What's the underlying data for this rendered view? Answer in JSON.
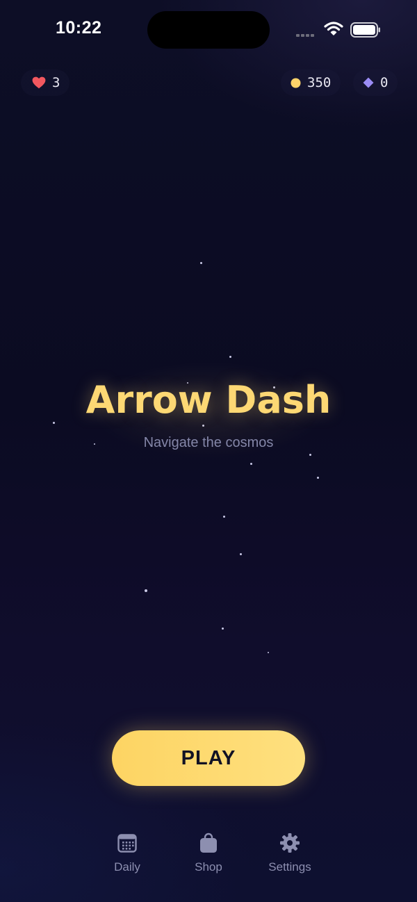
{
  "status_bar": {
    "time": "10:22"
  },
  "hud": {
    "lives": "3",
    "coins": "350",
    "gems": "0",
    "colors": {
      "heart": "#f2585f",
      "coin": "#fdd36a",
      "gem": "#9b8cf5"
    }
  },
  "title": {
    "text": "Arrow Dash",
    "subtitle": "Navigate the cosmos",
    "color": "#fdd874"
  },
  "play_button": {
    "label": "PLAY",
    "color": "#fdd463"
  },
  "nav": {
    "items": [
      {
        "label": "Daily",
        "icon": "calendar-icon"
      },
      {
        "label": "Shop",
        "icon": "shopping-bag-icon"
      },
      {
        "label": "Settings",
        "icon": "gear-icon"
      }
    ]
  }
}
